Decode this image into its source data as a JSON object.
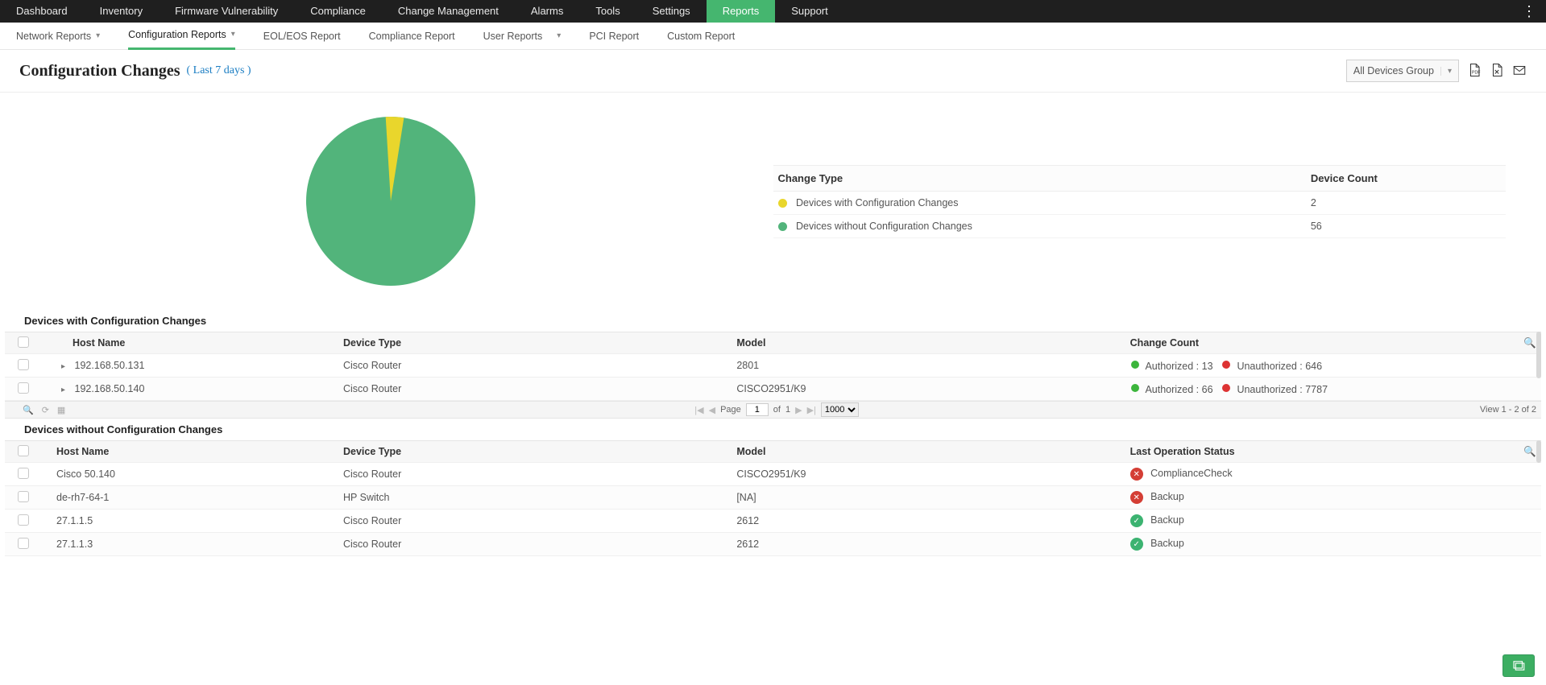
{
  "topnav": {
    "items": [
      {
        "label": "Dashboard"
      },
      {
        "label": "Inventory"
      },
      {
        "label": "Firmware Vulnerability"
      },
      {
        "label": "Compliance"
      },
      {
        "label": "Change Management"
      },
      {
        "label": "Alarms"
      },
      {
        "label": "Tools"
      },
      {
        "label": "Settings"
      },
      {
        "label": "Reports",
        "active": true
      },
      {
        "label": "Support"
      }
    ]
  },
  "subnav": {
    "items": [
      {
        "label": "Network Reports",
        "dropdown": true
      },
      {
        "label": "Configuration Reports",
        "dropdown": true,
        "active": true
      },
      {
        "label": "EOL/EOS Report"
      },
      {
        "label": "Compliance Report"
      },
      {
        "label": "User Reports",
        "dropdown": true
      },
      {
        "label": "PCI Report"
      },
      {
        "label": "Custom Report"
      }
    ]
  },
  "header": {
    "title": "Configuration Changes",
    "subtitle": "( Last 7 days )",
    "selector": "All Devices Group"
  },
  "chart_data": {
    "type": "pie",
    "title": "",
    "series": [
      {
        "name": "Devices with Configuration Changes",
        "value": 2,
        "color": "#e9d62c"
      },
      {
        "name": "Devices without Configuration Changes",
        "value": 56,
        "color": "#52b47b"
      }
    ],
    "legend_headers": {
      "type": "Change Type",
      "count": "Device Count"
    }
  },
  "table1": {
    "title": "Devices with Configuration Changes",
    "columns": [
      "Host Name",
      "Device Type",
      "Model",
      "Change Count"
    ],
    "rows": [
      {
        "host": "192.168.50.131",
        "deviceType": "Cisco Router",
        "model": "2801",
        "authorized": 13,
        "unauthorized": 646
      },
      {
        "host": "192.168.50.140",
        "deviceType": "Cisco Router",
        "model": "CISCO2951/K9",
        "authorized": 66,
        "unauthorized": 7787
      }
    ],
    "change_labels": {
      "authorized": "Authorized : ",
      "unauthorized": "Unauthorized : "
    },
    "pager": {
      "page_label": "Page",
      "page": "1",
      "of_label": "of",
      "total_pages": "1",
      "page_size": "1000"
    },
    "view": "View 1 - 2 of 2"
  },
  "table2": {
    "title": "Devices without Configuration Changes",
    "columns": [
      "Host Name",
      "Device Type",
      "Model",
      "Last Operation Status"
    ],
    "rows": [
      {
        "host": "Cisco 50.140",
        "deviceType": "Cisco Router",
        "model": "CISCO2951/K9",
        "status": "ComplianceCheck",
        "ok": false
      },
      {
        "host": "de-rh7-64-1",
        "deviceType": "HP Switch",
        "model": "[NA]",
        "status": "Backup",
        "ok": false
      },
      {
        "host": "27.1.1.5",
        "deviceType": "Cisco Router",
        "model": "2612",
        "status": "Backup",
        "ok": true
      },
      {
        "host": "27.1.1.3",
        "deviceType": "Cisco Router",
        "model": "2612",
        "status": "Backup",
        "ok": true
      }
    ]
  }
}
